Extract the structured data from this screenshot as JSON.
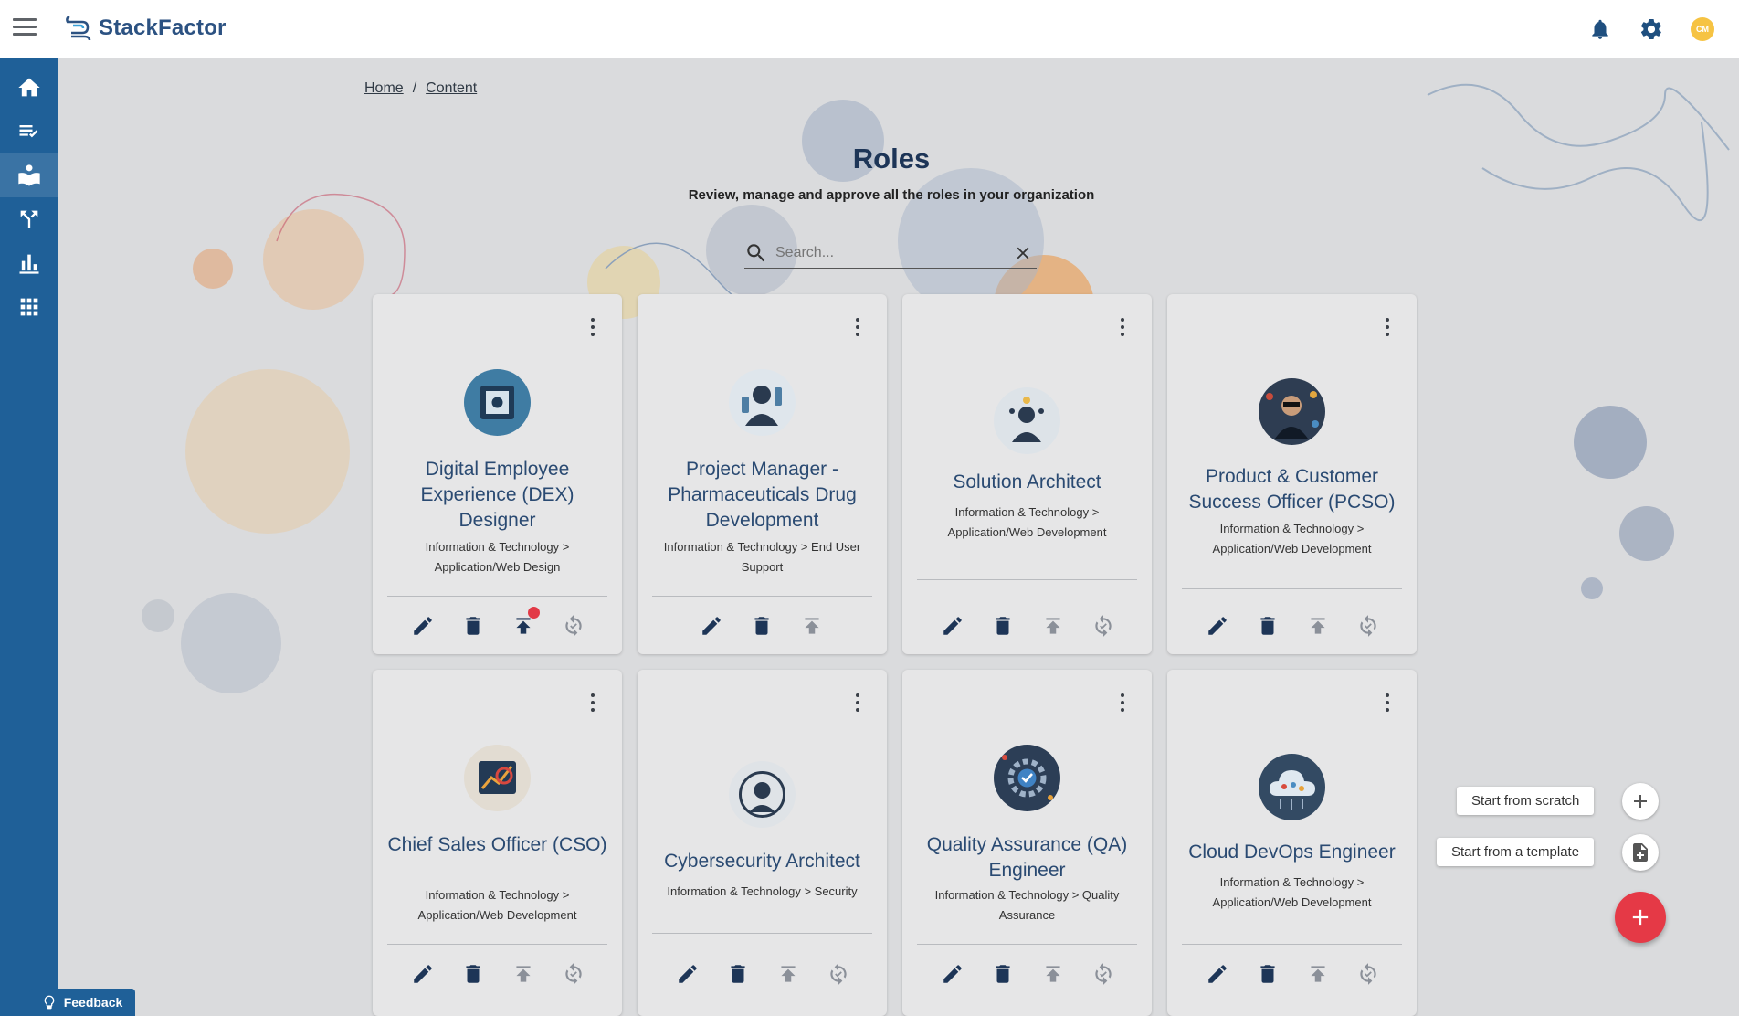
{
  "app": {
    "name": "StackFactor",
    "avatar_initials": "CM"
  },
  "colors": {
    "primary": "#1f6098",
    "accent": "#e53946",
    "title": "#1d3557"
  },
  "header_icons": [
    "bell-icon",
    "gear-icon",
    "avatar"
  ],
  "sidebar": {
    "items": [
      {
        "name": "home",
        "icon": "home-icon"
      },
      {
        "name": "checklist",
        "icon": "checklist-icon"
      },
      {
        "name": "content",
        "icon": "book-reader-icon",
        "active": true
      },
      {
        "name": "paths",
        "icon": "fork-icon"
      },
      {
        "name": "analytics",
        "icon": "bar-chart-icon"
      },
      {
        "name": "apps",
        "icon": "grid-icon"
      }
    ]
  },
  "breadcrumb": {
    "home": "Home",
    "separator": "/",
    "current": "Content"
  },
  "page": {
    "title": "Roles",
    "subtitle": "Review, manage and approve all the roles in your organization"
  },
  "search": {
    "placeholder": "Search...",
    "value": ""
  },
  "cards": [
    {
      "title": "Digital Employee Experience (DEX) Designer",
      "category": "Information & Technology > Application/Web Design",
      "actions": [
        "edit",
        "delete",
        "publish",
        "sync"
      ],
      "notification": true
    },
    {
      "title": "Project Manager - Pharmaceuticals Drug Development",
      "category": "Information & Technology > End User Support",
      "actions": [
        "edit",
        "delete",
        "publish"
      ]
    },
    {
      "title": "Solution Architect",
      "category": "Information & Technology > Application/Web Development",
      "actions": [
        "edit",
        "delete",
        "publish",
        "sync"
      ]
    },
    {
      "title": "Product & Customer Success Officer (PCSO)",
      "category": "Information & Technology > Application/Web Development",
      "actions": [
        "edit",
        "delete",
        "publish",
        "sync"
      ]
    },
    {
      "title": "Chief Sales Officer (CSO)",
      "category": "Information & Technology > Application/Web Development",
      "actions": [
        "edit",
        "delete",
        "publish",
        "sync"
      ]
    },
    {
      "title": "Cybersecurity Architect",
      "category": "Information & Technology > Security",
      "actions": [
        "edit",
        "delete",
        "publish",
        "sync"
      ]
    },
    {
      "title": "Quality Assurance (QA) Engineer",
      "category": "Information & Technology > Quality Assurance",
      "actions": [
        "edit",
        "delete",
        "publish",
        "sync"
      ]
    },
    {
      "title": "Cloud DevOps Engineer",
      "category": "Information & Technology > Application/Web Development",
      "actions": [
        "edit",
        "delete",
        "publish",
        "sync"
      ]
    }
  ],
  "fab_menu": {
    "scratch_label": "Start from scratch",
    "template_label": "Start from a template"
  },
  "feedback": {
    "label": "Feedback"
  }
}
